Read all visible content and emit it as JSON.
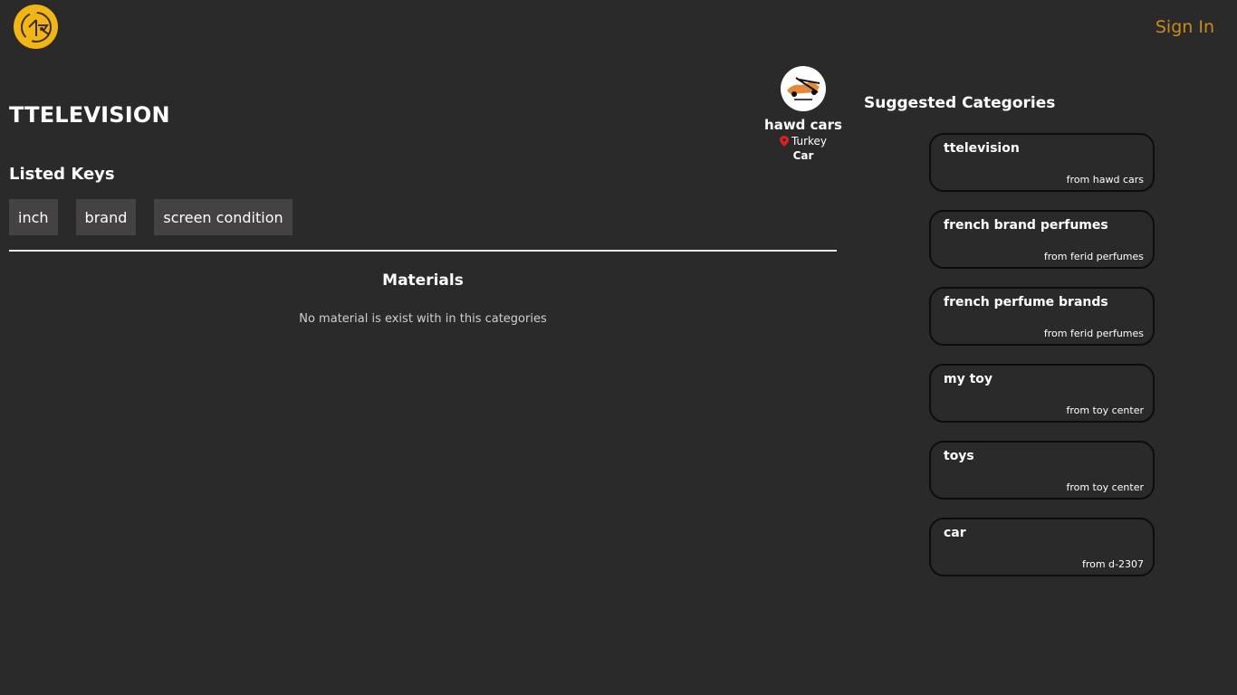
{
  "header": {
    "logo_icon": "site-logo",
    "signin_label": "Sign In"
  },
  "category": {
    "title": "TTELEVISION"
  },
  "listed_keys": {
    "title": "Listed Keys",
    "items": [
      {
        "label": "inch"
      },
      {
        "label": "brand"
      },
      {
        "label": "screen condition"
      }
    ]
  },
  "materials": {
    "title": "Materials",
    "empty_text": "No material is exist with in this categories"
  },
  "seller": {
    "avatar_icon": "car-logo",
    "name": "hawd cars",
    "location": "Turkey",
    "category": "Car"
  },
  "suggested": {
    "title": "Suggested Categories",
    "items": [
      {
        "name": "ttelevision",
        "from": "from hawd cars"
      },
      {
        "name": "french brand perfumes",
        "from": "from ferid perfumes"
      },
      {
        "name": "french perfume brands",
        "from": "from ferid perfumes"
      },
      {
        "name": "my toy",
        "from": "from toy center"
      },
      {
        "name": "toys",
        "from": "from toy center"
      },
      {
        "name": "car",
        "from": "from d-2307"
      }
    ]
  },
  "colors": {
    "background": "#2a2a2a",
    "accent": "#f2b517",
    "signin": "#c98a1e",
    "chip": "#444242"
  }
}
